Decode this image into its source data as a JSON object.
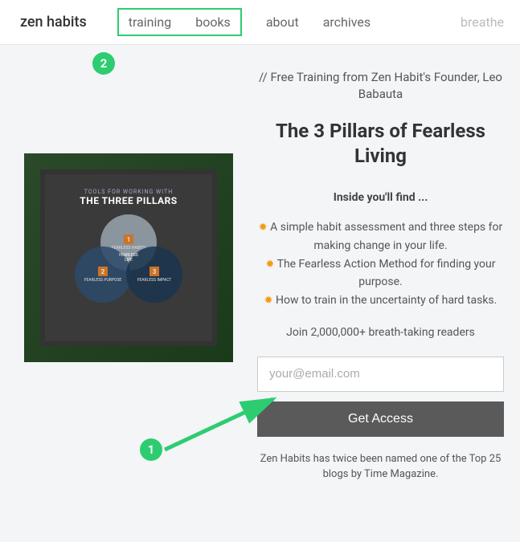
{
  "header": {
    "logo": "zen habits",
    "nav_highlighted": [
      "training",
      "books"
    ],
    "nav_regular": [
      "about",
      "archives"
    ],
    "nav_right": "breathe"
  },
  "graphic": {
    "subtitle": "TOOLS FOR WORKING WITH",
    "title": "THE THREE PILLARS",
    "circles": [
      {
        "num": "1",
        "label": "FEARLESS HABITS"
      },
      {
        "num": "2",
        "label": "FEARLESS PURPOSE"
      },
      {
        "num": "3",
        "label": "FEARLESS IMPACT"
      }
    ],
    "center": "FEARLESS LIFE"
  },
  "content": {
    "tagline": "// Free Training from Zen Habit's Founder, Leo Babauta",
    "headline": "The 3 Pillars of Fearless Living",
    "inside_label": "Inside you'll find ...",
    "bullets": [
      "A simple habit assessment and three steps for making change in your life.",
      "The Fearless Action Method for finding your purpose.",
      "How to train in the uncertainty of hard tasks."
    ],
    "join": "Join 2,000,000+ breath-taking readers",
    "email_placeholder": "your@email.com",
    "button": "Get Access",
    "footnote": "Zen Habits has twice been named one of the Top 25 blogs by Time Magazine."
  },
  "annotations": {
    "badge1": "1",
    "badge2": "2"
  }
}
